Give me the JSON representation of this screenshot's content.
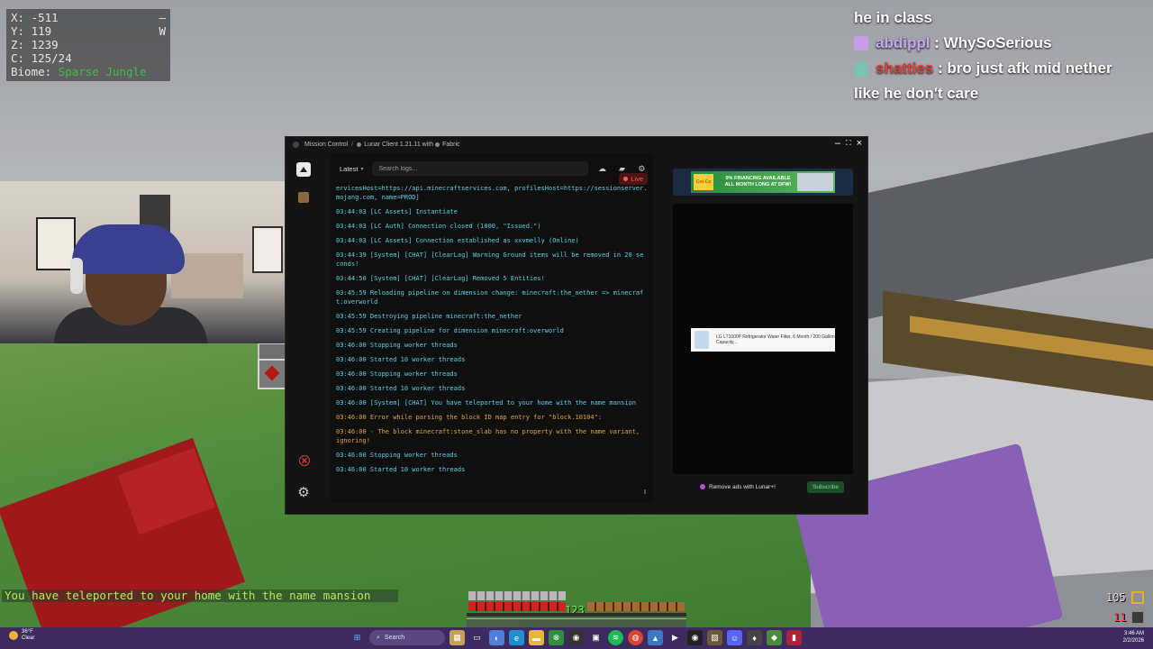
{
  "game": {
    "coords": {
      "x_label": "X: -511",
      "y_label": "Y: 119",
      "z_label": "Z: 1239",
      "c_label": "C: 125/24",
      "biome_label": "Biome:",
      "biome_value": "Sparse Jungle",
      "right1": "–",
      "right2": "W"
    },
    "chat_message": "You have teleported to your home with the name mansion",
    "xp_level": "123",
    "item_count1": "105",
    "item_count2": "11"
  },
  "stream_chat": [
    {
      "user": "",
      "text": "he in class"
    },
    {
      "user": "abdippl",
      "sep": " : ",
      "text": "WhySoSerious"
    },
    {
      "user": "shatties",
      "sep": " : ",
      "text": "bro just afk mid nether like he don't care"
    }
  ],
  "window": {
    "breadcrumb1": "Mission Control",
    "breadcrumb_sep": "/",
    "breadcrumb2": "Lunar Client 1.21.11 with",
    "breadcrumb2_suffix": "Fabric",
    "minimize": "–",
    "maximize": "⛶",
    "close": "×"
  },
  "logs": {
    "version_dropdown": "Latest",
    "search_placeholder": "Search logs...",
    "live_label": "Live",
    "entries": [
      {
        "text": "ervicesHost=https://api.minecraftservices.com, profilesHost=https://sessionserver.\nmojang.com, name=PROD]",
        "type": "info"
      },
      {
        "text": "03:44:03 [LC Assets] Instantiate",
        "type": "info"
      },
      {
        "text": "03:44:03 [LC Auth] Connection closed (1000, \"Issued.\")",
        "type": "info"
      },
      {
        "text": "03:44:03 [LC Assets] Connection established as xxvmelly (Online)",
        "type": "info"
      },
      {
        "text": "03:44:39 [System] [CHAT] [ClearLag] Warning Ground items will be removed in 20 se\nconds!",
        "type": "info"
      },
      {
        "text": "03:44:50 [System] [CHAT] [ClearLag] Removed 5 Entities!",
        "type": "info"
      },
      {
        "text": "03:45:59 Reloading pipeline on dimension change: minecraft:the_nether => minecraf\nt:overworld",
        "type": "info"
      },
      {
        "text": "03:45:59 Destroying pipeline minecraft:the_nether",
        "type": "info"
      },
      {
        "text": "03:45:59 Creating pipeline for dimension minecraft:overworld",
        "type": "info"
      },
      {
        "text": "03:46:00 Stopping worker threads",
        "type": "info"
      },
      {
        "text": "03:46:00 Started 10 worker threads",
        "type": "info"
      },
      {
        "text": "03:46:00 Stopping worker threads",
        "type": "info"
      },
      {
        "text": "03:46:00 Started 10 worker threads",
        "type": "info"
      },
      {
        "text": "03:46:00 [System] [CHAT] You have teleported to your home with the name mansion",
        "type": "info"
      },
      {
        "text": "03:46:00 Error while parsing the block ID map entry for \"block.10104\":",
        "type": "error"
      },
      {
        "text": "03:46:00 - The block minecraft:stone_slab has no property with the name variant,\nignoring!",
        "type": "error"
      },
      {
        "text": "03:46:00 Stopping worker threads",
        "type": "info"
      },
      {
        "text": "03:46:00 Started 10 worker threads",
        "type": "info"
      }
    ]
  },
  "ads": {
    "top_store": "Cut-Ca",
    "top_text": "0% FINANCING AVAILABLE\nALL MONTH LONG AT DFW!",
    "mid_text": "LG LT1000P Refrigerator Water Filter, 6 Month / 200 Gallon Capacity...",
    "remove_ads": "Remove ads with Lunar+!",
    "subscribe": "Subscribe"
  },
  "taskbar": {
    "weather_temp": "36°F",
    "weather_desc": "Clear",
    "search_label": "Search",
    "time": "3:46 AM",
    "date": "2/2/2026"
  }
}
